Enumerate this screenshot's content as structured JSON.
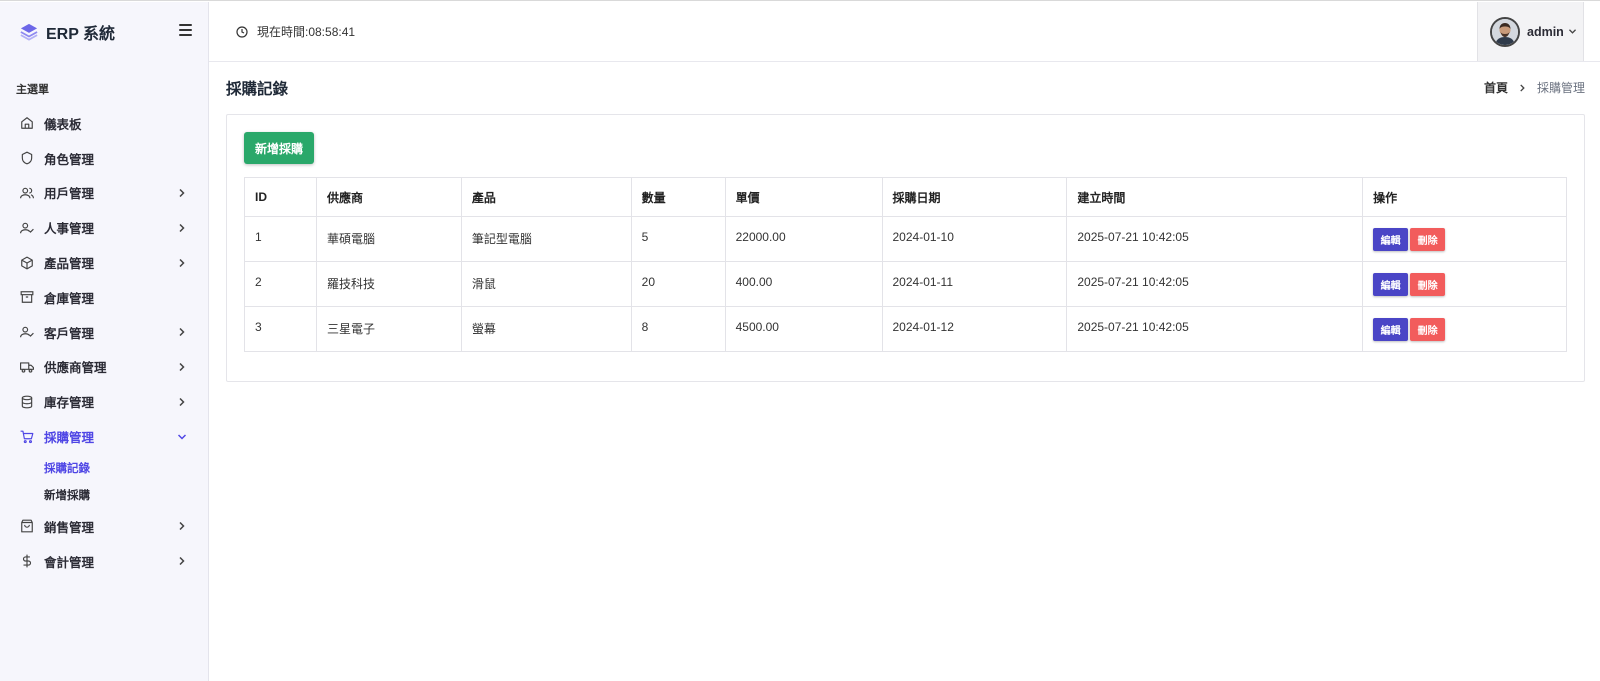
{
  "app": {
    "brand": "ERP 系統"
  },
  "topbar": {
    "clock_text": "現在時間:08:58:41",
    "user_name": "admin"
  },
  "sidebar": {
    "section_label": "主選單",
    "items": [
      {
        "label": "儀表板",
        "icon": "home-icon",
        "has_children": false
      },
      {
        "label": "角色管理",
        "icon": "shield-icon",
        "has_children": false
      },
      {
        "label": "用戶管理",
        "icon": "users-icon",
        "has_children": true
      },
      {
        "label": "人事管理",
        "icon": "user-check-icon",
        "has_children": true
      },
      {
        "label": "產品管理",
        "icon": "package-icon",
        "has_children": true
      },
      {
        "label": "倉庫管理",
        "icon": "archive-icon",
        "has_children": false
      },
      {
        "label": "客戶管理",
        "icon": "user-check-icon",
        "has_children": true
      },
      {
        "label": "供應商管理",
        "icon": "truck-icon",
        "has_children": true
      },
      {
        "label": "庫存管理",
        "icon": "database-icon",
        "has_children": true
      },
      {
        "label": "採購管理",
        "icon": "cart-icon",
        "has_children": true,
        "expanded": true,
        "active": true,
        "children": [
          {
            "label": "採購記錄",
            "active": true
          },
          {
            "label": "新增採購"
          }
        ]
      },
      {
        "label": "銷售管理",
        "icon": "shopping-bag-icon",
        "has_children": true
      },
      {
        "label": "會計管理",
        "icon": "dollar-icon",
        "has_children": true
      }
    ]
  },
  "page": {
    "title": "採購記錄",
    "breadcrumb": {
      "home": "首頁",
      "current": "採購管理"
    },
    "add_button": "新增採購"
  },
  "table": {
    "headers": [
      "ID",
      "供應商",
      "產品",
      "數量",
      "單價",
      "採購日期",
      "建立時間",
      "操作"
    ],
    "rows": [
      [
        "1",
        "華碩電腦",
        "筆記型電腦",
        "5",
        "22000.00",
        "2024-01-10",
        "2025-07-21 10:42:05"
      ],
      [
        "2",
        "羅技科技",
        "滑鼠",
        "20",
        "400.00",
        "2024-01-11",
        "2025-07-21 10:42:05"
      ],
      [
        "3",
        "三星電子",
        "螢幕",
        "8",
        "4500.00",
        "2024-01-12",
        "2025-07-21 10:42:05"
      ]
    ],
    "actions": {
      "edit": "編輯",
      "delete": "刪除"
    }
  },
  "colors": {
    "accent": "#4f46e5",
    "add_button": "#2aa86a",
    "edit_button": "#4a45c6",
    "delete_button": "#f25c5c"
  }
}
